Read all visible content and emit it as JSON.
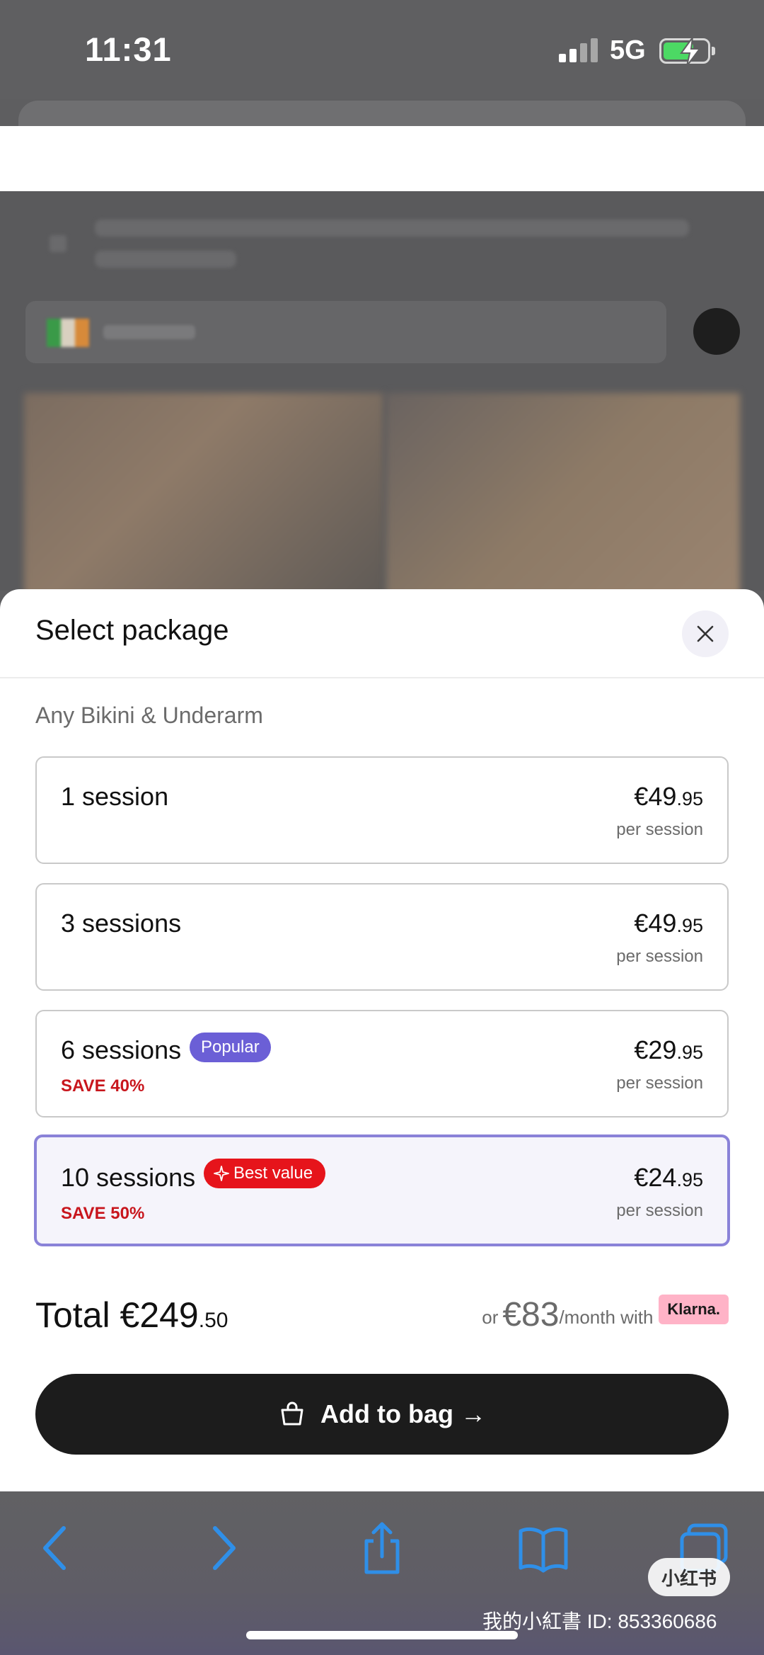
{
  "status_bar": {
    "time": "11:31",
    "network": "5G",
    "battery_level": 0.6,
    "battery_charging": true
  },
  "sheet": {
    "title": "Select package",
    "subtitle": "Any Bikini & Underarm",
    "close_icon": "close-icon",
    "options": [
      {
        "name": "1 session",
        "price_whole": "€49",
        "price_cents": ".95",
        "per": "per session",
        "badge": "",
        "save": "",
        "selected": false
      },
      {
        "name": "3 sessions",
        "price_whole": "€49",
        "price_cents": ".95",
        "per": "per session",
        "badge": "",
        "save": "",
        "selected": false
      },
      {
        "name": "6 sessions",
        "price_whole": "€29",
        "price_cents": ".95",
        "per": "per session",
        "badge": "Popular",
        "save": "SAVE 40%",
        "selected": false
      },
      {
        "name": "10 sessions",
        "price_whole": "€24",
        "price_cents": ".95",
        "per": "per session",
        "badge": "Best value",
        "save": "SAVE 50%",
        "selected": true
      }
    ],
    "total": {
      "label": "Total €249",
      "cents": ".50"
    },
    "klarna": {
      "prefix": "or",
      "amount": "€83",
      "suffix": "/month with",
      "badge": "Klarna."
    },
    "add_button": {
      "label": "Add to bag",
      "arrow": "→",
      "icon": "shopping-bag-icon"
    }
  },
  "toolbar": {
    "icons": [
      "back-icon",
      "forward-icon",
      "share-icon",
      "bookmarks-icon",
      "tabs-icon"
    ]
  },
  "watermark": {
    "logo": "小红书",
    "text": "我的小紅書 ID: 853360686"
  },
  "colors": {
    "accent_purple": "#6b5fd6",
    "selected_border": "#8a82d8",
    "best_value_red": "#e6141b",
    "save_red": "#c8161d",
    "button_black": "#1c1c1c",
    "klarna_pink": "#ffb3c7",
    "ios_blue": "#2f8fe8"
  }
}
